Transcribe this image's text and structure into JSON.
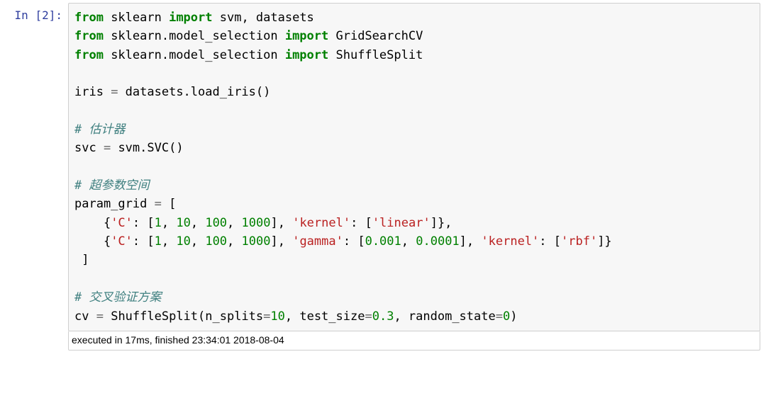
{
  "prompt": {
    "label": "In",
    "open": "[",
    "num": "2",
    "close": "]:",
    "spaces": "  "
  },
  "code": {
    "l1": {
      "a": "from",
      "b": " sklearn ",
      "c": "import",
      "d": " svm, datasets"
    },
    "l2": {
      "a": "from",
      "b": " sklearn.model_selection ",
      "c": "import",
      "d": " GridSearchCV"
    },
    "l3": {
      "a": "from",
      "b": " sklearn.model_selection ",
      "c": "import",
      "d": " ShuffleSplit"
    },
    "l5": {
      "a": "iris ",
      "op": "=",
      "b": " datasets.load_iris()"
    },
    "l7": {
      "c": "# 估计器"
    },
    "l8": {
      "a": "svc ",
      "op": "=",
      "b": " svm.SVC()"
    },
    "l10": {
      "c": "# 超参数空间"
    },
    "l11": {
      "a": "param_grid ",
      "op": "=",
      "b": " ["
    },
    "l12": {
      "ind": "    {",
      "k1": "'C'",
      "c1": ": [",
      "v1": "1",
      "s1": ", ",
      "v2": "10",
      "s2": ", ",
      "v3": "100",
      "s3": ", ",
      "v4": "1000",
      "c2": "], ",
      "k2": "'kernel'",
      "c3": ": [",
      "v5": "'linear'",
      "c4": "]},"
    },
    "l13": {
      "ind": "    {",
      "k1": "'C'",
      "c1": ": [",
      "v1": "1",
      "s1": ", ",
      "v2": "10",
      "s2": ", ",
      "v3": "100",
      "s3": ", ",
      "v4": "1000",
      "c2": "], ",
      "k2": "'gamma'",
      "c3": ": [",
      "g1": "0.001",
      "s4": ", ",
      "g2": "0.0001",
      "c4": "], ",
      "k3": "'kernel'",
      "c5": ": [",
      "v5": "'rbf'",
      "c6": "]}"
    },
    "l14": {
      "a": " ]"
    },
    "l16": {
      "c": "# 交叉验证方案"
    },
    "l17": {
      "a": "cv ",
      "op": "=",
      "b": " ShuffleSplit(n_splits",
      "op2": "=",
      "v1": "10",
      "s1": ", test_size",
      "op3": "=",
      "v2": "0.3",
      "s2": ", random_state",
      "op4": "=",
      "v3": "0",
      "end": ")"
    }
  },
  "exec": {
    "text": "executed in 17ms, finished 23:34:01 2018-08-04"
  }
}
